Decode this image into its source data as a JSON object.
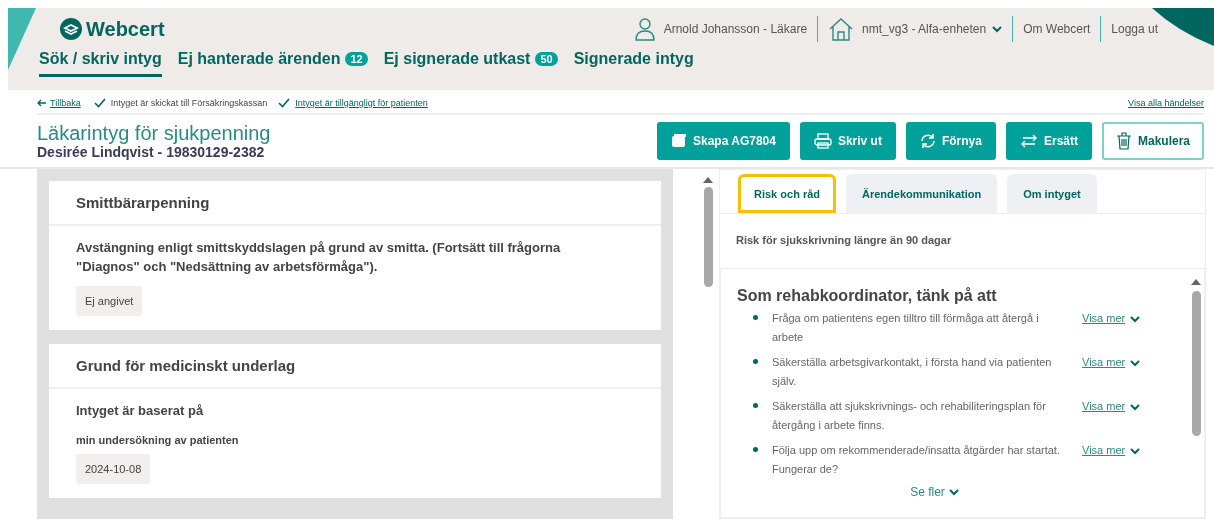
{
  "header": {
    "logo": "Webcert",
    "user": "Arnold Johansson - Läkare",
    "unit": "nmt_vg3 - Alfa-enheten",
    "links": [
      "Om Webcert",
      "Logga ut"
    ]
  },
  "nav": [
    {
      "label": "Sök / skriv intyg",
      "selected": true
    },
    {
      "label": "Ej hanterade ärenden",
      "badge": "12",
      "selected": false
    },
    {
      "label": "Ej signerade utkast",
      "badge": "50",
      "selected": false
    },
    {
      "label": "Signerade intyg",
      "selected": false
    }
  ],
  "status_bar": {
    "back": "Tillbaka",
    "events": [
      {
        "text": "Intyget är skickat till Försäkringskassan",
        "link": false
      },
      {
        "text": "Intyget är tillgängligt för patienten",
        "link": true
      }
    ],
    "all_events": "Visa alla händelser"
  },
  "certificate": {
    "title": "Läkarintyg för sjukpenning",
    "patient": "Desirée Lindqvist - 19830129-2382"
  },
  "actions": [
    {
      "label": "Skapa AG7804",
      "kind": "copy"
    },
    {
      "label": "Skriv ut",
      "kind": "print"
    },
    {
      "label": "Förnya",
      "kind": "renew"
    },
    {
      "label": "Ersätt",
      "kind": "replace"
    },
    {
      "label": "Makulera",
      "kind": "delete"
    }
  ],
  "sections": [
    {
      "title": "Smittbärarpenning",
      "question": "Avstängning enligt smittskyddslagen på grund av smitta. (Fortsätt till frågorna \"Diagnos\" och \"Nedsättning av arbetsförmåga\").",
      "answers": [
        {
          "value": "Ej angivet"
        }
      ]
    },
    {
      "title": "Grund för medicinskt underlag",
      "question": "Intyget är baserat på",
      "answers": [
        {
          "label": "min undersökning av patienten",
          "value": "2024-10-08"
        }
      ]
    }
  ],
  "tabs": [
    {
      "label": "Risk och råd",
      "selected": true
    },
    {
      "label": "Ärendekommunikation",
      "selected": false
    },
    {
      "label": "Om intyget",
      "selected": false
    }
  ],
  "risk_text": "Risk för sjukskrivning längre än 90 dagar",
  "advice": {
    "title": "Som rehabkoordinator, tänk på att",
    "items": [
      {
        "text": "Fråga om patientens egen tilltro till förmåga att återgå i arbete",
        "link": "Visa mer"
      },
      {
        "text": "Säkerställa arbetsgivarkontakt, i första hand via patienten själv.",
        "link": "Visa mer"
      },
      {
        "text": "Säkerställa att sjukskrivnings- och rehabiliteringsplan för återgång i arbete finns.",
        "link": "Visa mer"
      },
      {
        "text": "Följa upp om rekommenderade/insatta åtgärder har startat. Fungerar de?",
        "link": "Visa mer"
      }
    ],
    "more": "Se fler"
  }
}
